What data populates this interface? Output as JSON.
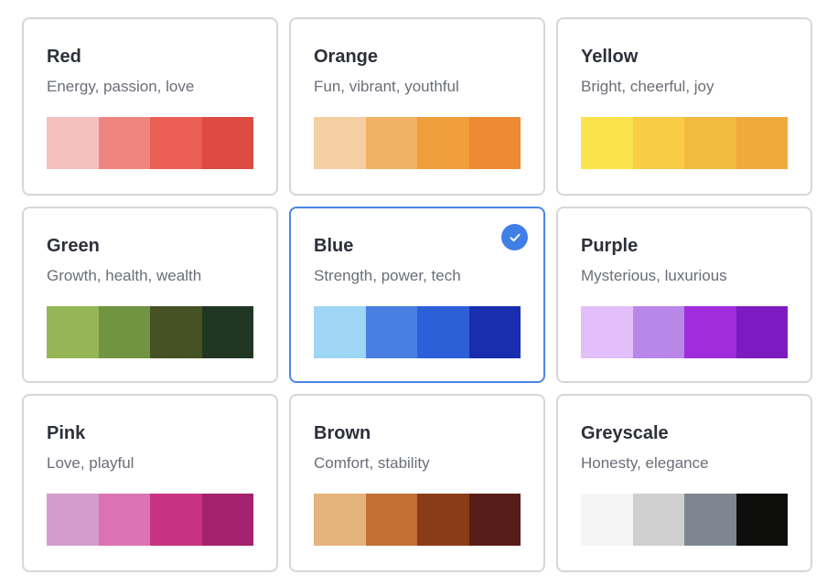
{
  "palettes": [
    {
      "title": "Red",
      "description": "Energy, passion, love",
      "selected": false,
      "colors": [
        "#f4c0c0",
        "#ef857f",
        "#ea5e56",
        "#dd4a3f"
      ]
    },
    {
      "title": "Orange",
      "description": "Fun, vibrant, youthful",
      "selected": false,
      "colors": [
        "#f4cfa3",
        "#f1b264",
        "#ef9e39",
        "#ee8a33"
      ]
    },
    {
      "title": "Yellow",
      "description": "Bright, cheerful, joy",
      "selected": false,
      "colors": [
        "#fbe34b",
        "#f8cc45",
        "#f3ba40",
        "#f0a93b"
      ]
    },
    {
      "title": "Green",
      "description": "Growth, health, wealth",
      "selected": false,
      "colors": [
        "#96b556",
        "#709441",
        "#465124",
        "#213623"
      ]
    },
    {
      "title": "Blue",
      "description": "Strength, power, tech",
      "selected": true,
      "colors": [
        "#9fd6f5",
        "#497ee2",
        "#2c5fd8",
        "#182eaf"
      ]
    },
    {
      "title": "Purple",
      "description": "Mysterious, luxurious",
      "selected": false,
      "colors": [
        "#e2befa",
        "#b987e8",
        "#a02cdb",
        "#7c1cc0"
      ]
    },
    {
      "title": "Pink",
      "description": "Love, playful",
      "selected": false,
      "colors": [
        "#d69bcd",
        "#da72b3",
        "#c73381",
        "#a3226d"
      ]
    },
    {
      "title": "Brown",
      "description": "Comfort, stability",
      "selected": false,
      "colors": [
        "#e5b37c",
        "#c46f34",
        "#8a3c19",
        "#581d18"
      ]
    },
    {
      "title": "Greyscale",
      "description": "Honesty, elegance",
      "selected": false,
      "colors": [
        "#f5f5f5",
        "#cfcfcf",
        "#7e8790",
        "#0e0e0d"
      ]
    }
  ],
  "selected_indicator_icon": "checkmark-icon",
  "accent_color": "#4a86e8"
}
